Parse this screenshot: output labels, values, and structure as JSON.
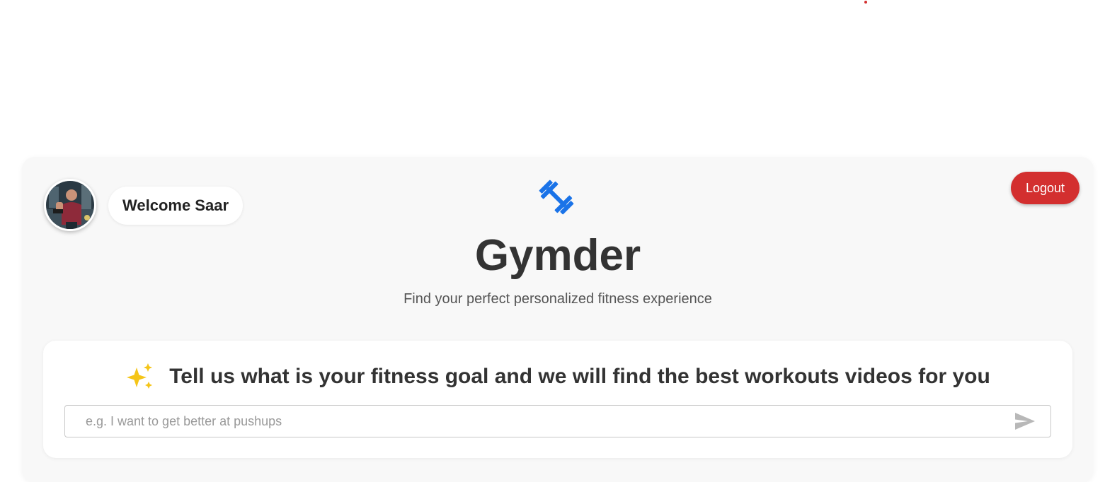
{
  "user": {
    "welcome_text": "Welcome Saar",
    "avatar_alt": "user-avatar"
  },
  "header": {
    "logout_label": "Logout"
  },
  "brand": {
    "icon": "dumbbell-icon",
    "title": "Gymder",
    "subtitle": "Find your perfect personalized fitness experience"
  },
  "goal": {
    "icon": "sparkle-icon",
    "heading": "Tell us what is your fitness goal and we will find the best workouts videos for you",
    "input_value": "",
    "placeholder": "e.g. I want to get better at pushups",
    "send_icon": "send-icon"
  },
  "colors": {
    "accent_blue": "#1a73e8",
    "logout_red": "#d32f2f",
    "sparkle_yellow": "#f5c518",
    "card_background": "#f8f8f8"
  }
}
